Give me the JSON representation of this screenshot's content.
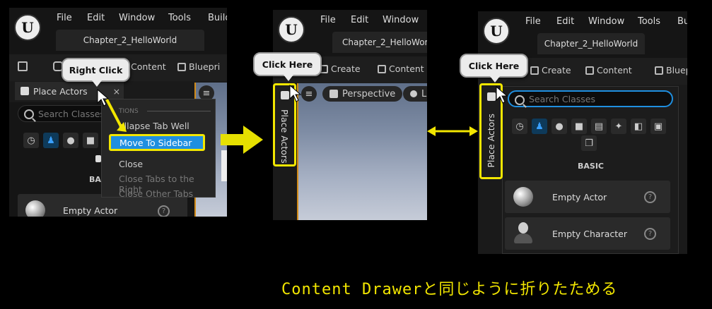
{
  "menu": {
    "file": "File",
    "edit": "Edit",
    "window": "Window",
    "tools": "Tools",
    "build": "Build",
    "build_cut": "Bui"
  },
  "tab_title": "Chapter_2_HelloWorld",
  "toolbar": {
    "content": "Content",
    "blueprint": "Bluepri",
    "blueprint3": "Bluep",
    "create": "Create"
  },
  "panel1": {
    "tab_label": "Place Actors",
    "close": "×",
    "search_placeholder": "Search Classes",
    "section": "BASIC",
    "section_cut": "BAS",
    "actor": "Empty Actor",
    "tooltip": "Right Click",
    "context_menu": {
      "header": "OPTIONS",
      "header_cut": "TIONS",
      "items": [
        "Collapse Tab Well",
        "Move To Sidebar",
        "Close",
        "Close Tabs to the Right",
        "Close Other Tabs"
      ],
      "item0_cut": "ollapse Tab Well"
    }
  },
  "panel2": {
    "tooltip": "Click Here",
    "vertical_tab": "Place Actors",
    "viewport_mode": "Perspective",
    "lit": "L"
  },
  "panel3": {
    "tooltip": "Click Here",
    "vertical_tab": "Place Actors",
    "search_placeholder": "Search Classes",
    "section": "BASIC",
    "actors": [
      "Empty Actor",
      "Empty Character"
    ]
  },
  "caption": "Content Drawerと同じように折りたためる",
  "colors": {
    "highlight": "#f2e600",
    "selection": "#1f8fe0",
    "accent": "#3aa0ff"
  }
}
